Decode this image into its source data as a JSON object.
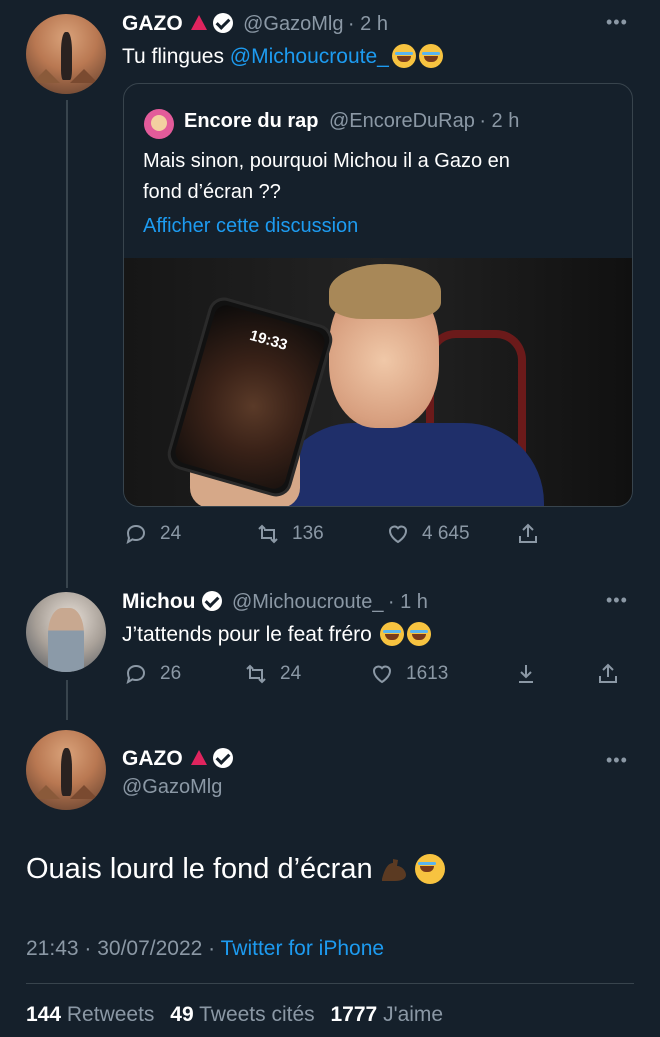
{
  "tweet1": {
    "author_name": "GAZO",
    "handle": "@GazoMlg",
    "time": "· 2 h",
    "text_prefix": "Tu flingues ",
    "mention": "@Michoucroute_",
    "more": "•••",
    "quoted": {
      "author_name": "Encore du rap",
      "handle": "@EncoreDuRap",
      "time": "· 2 h",
      "text_line1": "Mais sinon, pourquoi Michou il a Gazo en",
      "text_line2": "fond d’écran ??",
      "show_thread": "Afficher cette discussion",
      "phone_time": "19:33"
    },
    "replies": "24",
    "retweets": "136",
    "likes": "4 645"
  },
  "tweet2": {
    "author_name": "Michou",
    "handle": "@Michoucroute_",
    "time": "· 1 h",
    "text": "J’tattends pour le feat fréro",
    "more": "•••",
    "replies": "26",
    "retweets": "24",
    "likes": "1613"
  },
  "main_tweet": {
    "author_name": "GAZO",
    "handle": "@GazoMlg",
    "more": "•••",
    "text": "Ouais lourd le fond d’écran",
    "time": "21:43",
    "date": "30/07/2022",
    "source": "Twitter for iPhone",
    "stats": {
      "retweets_count": "144",
      "retweets_label": "Retweets",
      "quotes_count": "49",
      "quotes_label": "Tweets cités",
      "likes_count": "1777",
      "likes_label": "J'aime"
    }
  },
  "colors": {
    "background": "#15202b",
    "link": "#1d9bf0",
    "muted": "#8b98a5",
    "border": "#38444d"
  }
}
